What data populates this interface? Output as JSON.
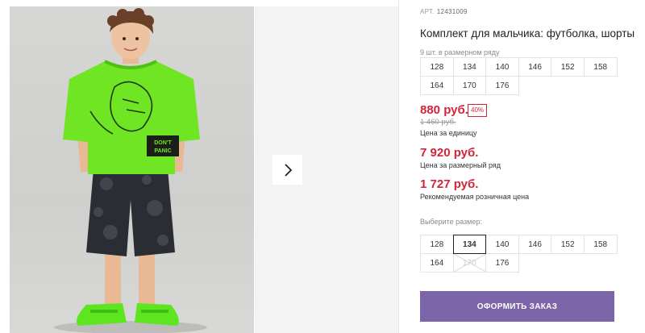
{
  "gallery": {
    "next_icon": "chevron-right-icon",
    "photo": "boy-in-green-tshirt-and-shorts"
  },
  "product": {
    "art_label": "АРТ.",
    "art_value": "12431009",
    "title": "Комплект для мальчика: футболка, шорты",
    "qty_note": "9 шт. в размерном ряду",
    "size_row": [
      "128",
      "134",
      "140",
      "146",
      "152",
      "158",
      "164",
      "170",
      "176"
    ]
  },
  "prices": {
    "unit_price": "880 руб.",
    "discount": "40%",
    "old_price": "1 460 руб.",
    "unit_label": "Цена за единицу",
    "row_price": "7 920 руб.",
    "row_label": "Цена за размерный ряд",
    "rrp_price": "1 727 руб.",
    "rrp_label": "Рекомендуемая розничная цена"
  },
  "size_select": {
    "label": "Выберите размер:",
    "sizes": [
      "128",
      "134",
      "140",
      "146",
      "152",
      "158",
      "164",
      "170",
      "176"
    ],
    "selected": "134",
    "disabled": "170"
  },
  "order_button": "ОФОРМИТЬ ЗАКАЗ",
  "colors": {
    "price": "#d4233a",
    "button": "#7b64a8",
    "shirt": "#6fe524",
    "shorts": "#2a2d33"
  }
}
